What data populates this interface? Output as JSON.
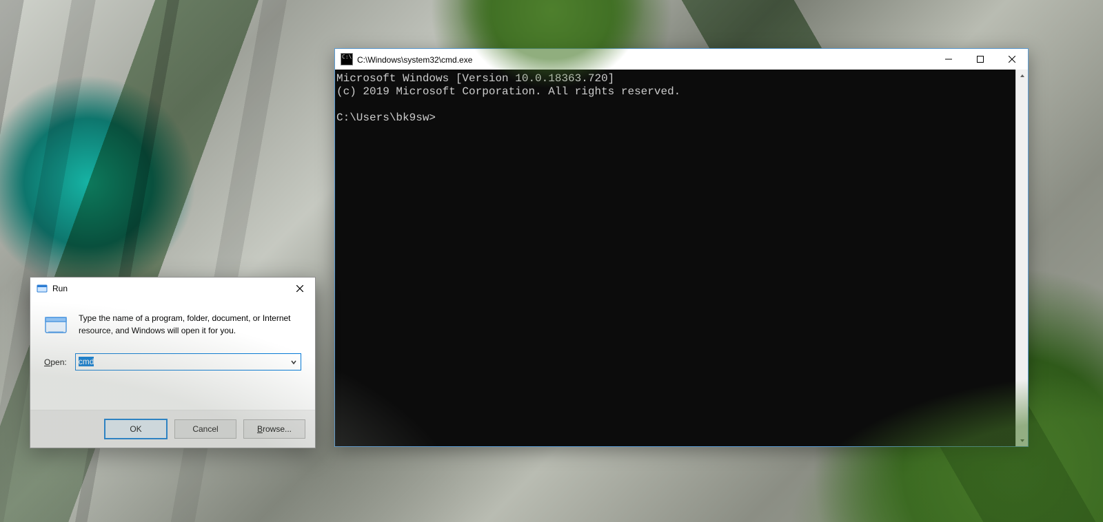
{
  "cmd": {
    "title": "C:\\Windows\\system32\\cmd.exe",
    "line1": "Microsoft Windows [Version 10.0.18363.720]",
    "line2": "(c) 2019 Microsoft Corporation. All rights reserved.",
    "prompt": "C:\\Users\\bk9sw>"
  },
  "run": {
    "title": "Run",
    "description": "Type the name of a program, folder, document, or Internet resource, and Windows will open it for you.",
    "open_letter": "O",
    "open_rest": "pen:",
    "input_value": "cmd",
    "ok": "OK",
    "cancel": "Cancel",
    "browse_letter": "B",
    "browse_rest": "rowse..."
  }
}
